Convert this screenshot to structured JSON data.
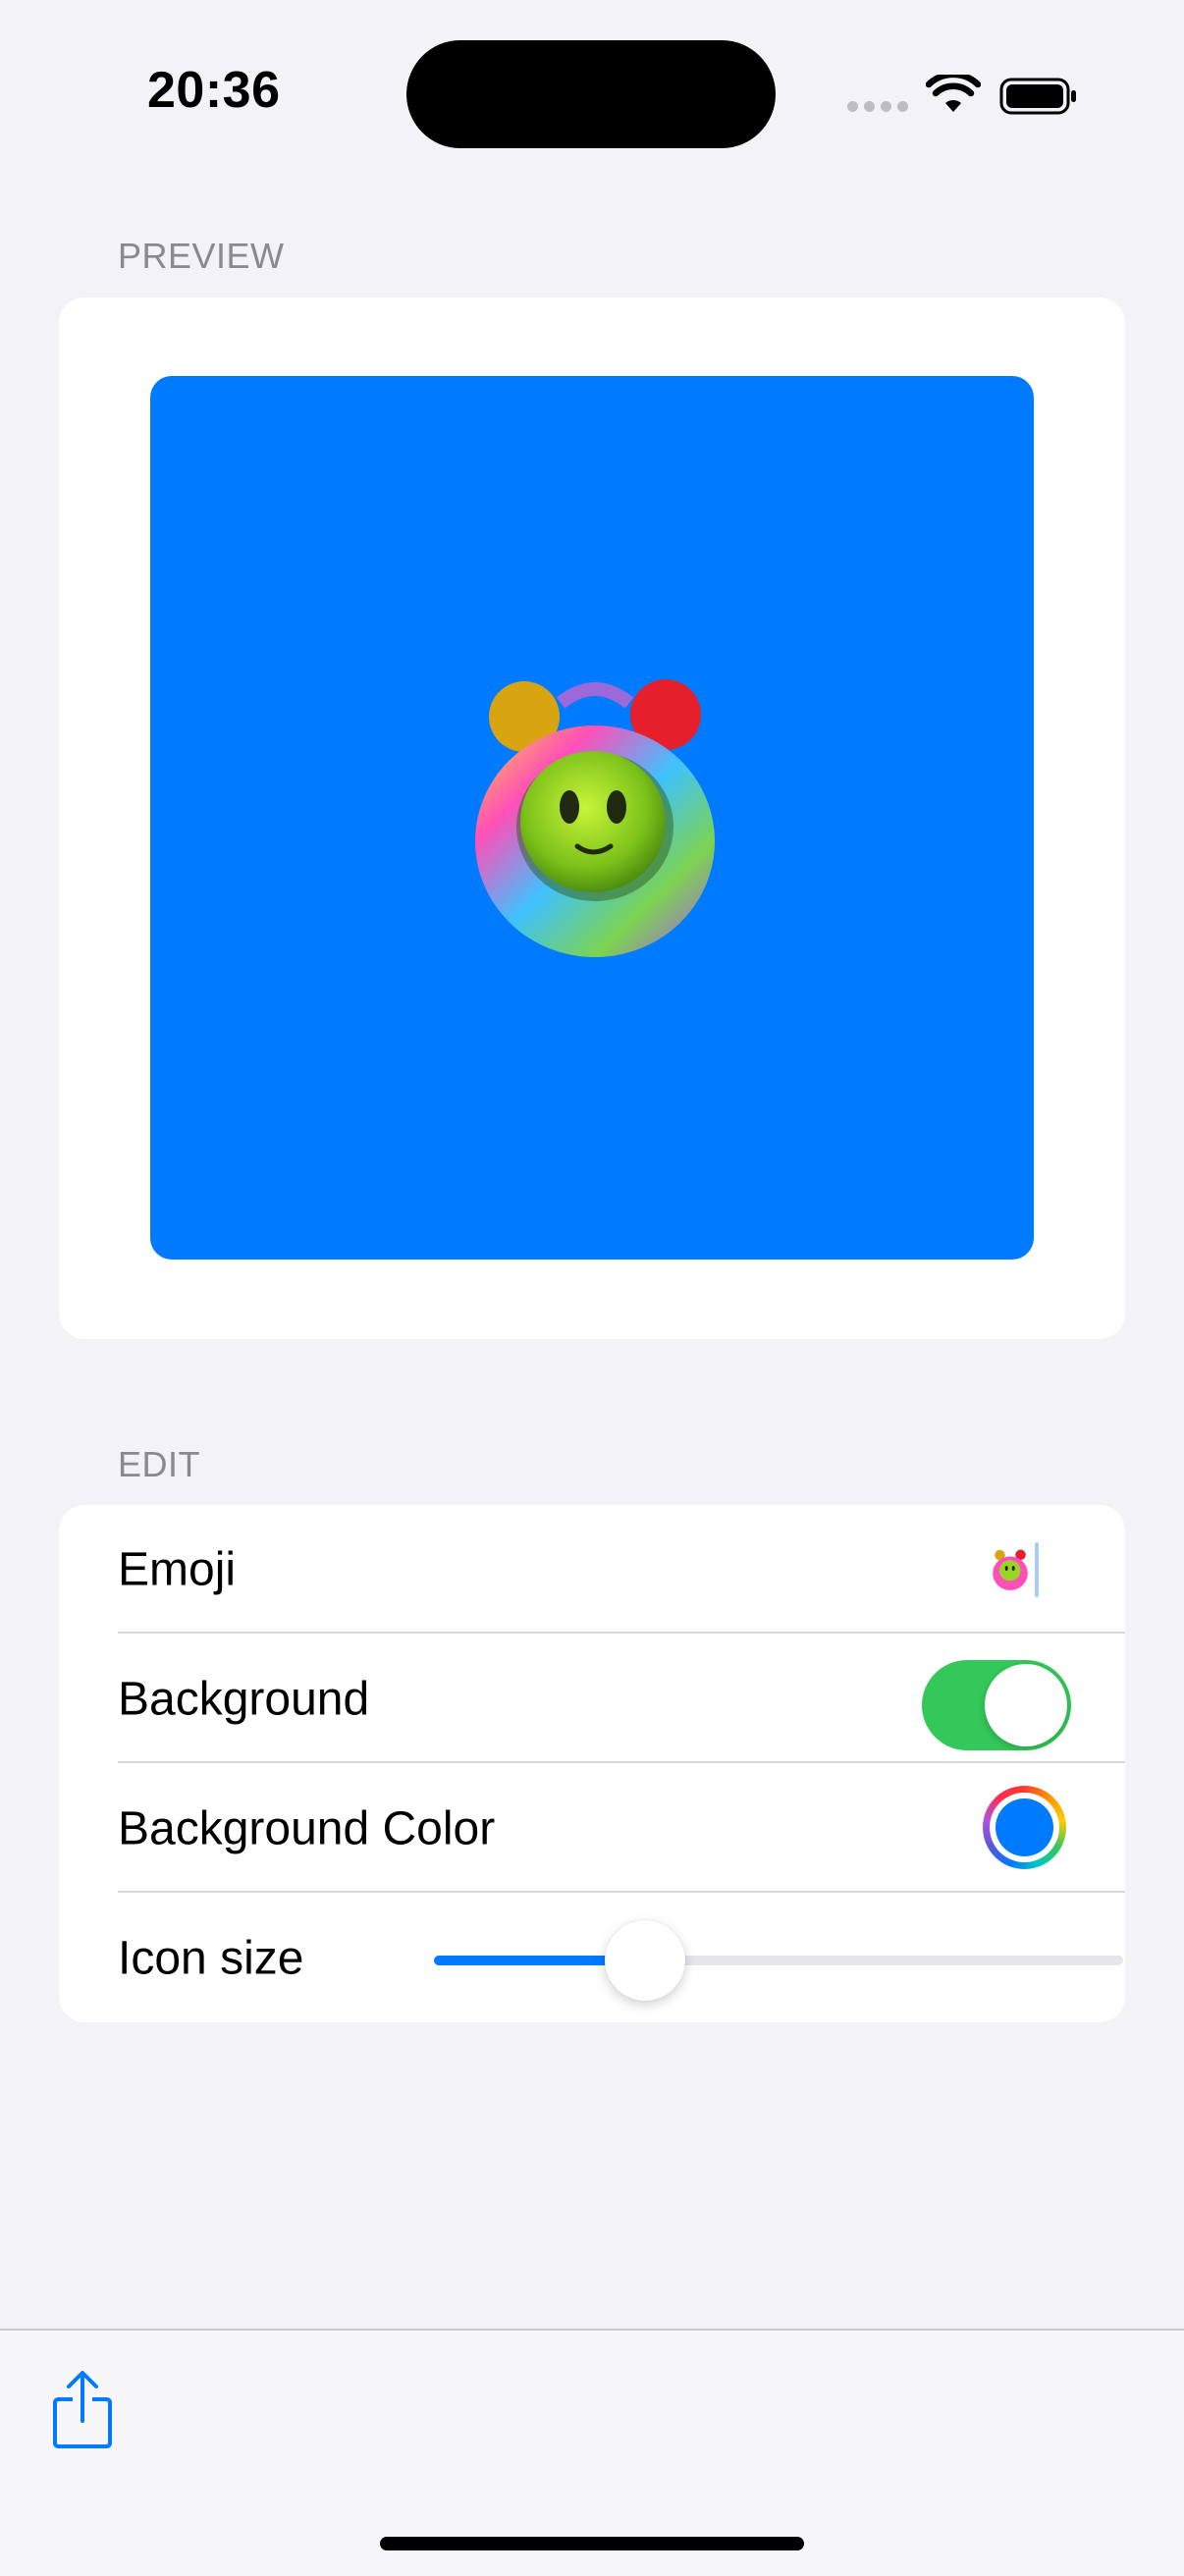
{
  "status_bar": {
    "time": "20:36",
    "icons": [
      "cellular-signal-icon",
      "wifi-icon",
      "battery-icon"
    ]
  },
  "preview": {
    "section_title": "PREVIEW",
    "background_color": "#007aff",
    "emoji": "🤖"
  },
  "edit": {
    "section_title": "EDIT",
    "emoji_label": "Emoji",
    "emoji_value": "🤖",
    "background_label": "Background",
    "background_enabled": true,
    "background_color_label": "Background Color",
    "background_color_value": "#007aff",
    "icon_size_label": "Icon size",
    "icon_size_fraction": 0.28
  },
  "toolbar": {
    "share_icon": "share-icon"
  },
  "colors": {
    "accent": "#007aff",
    "toggle_on": "#34c759",
    "page_background": "#f2f2f7"
  }
}
